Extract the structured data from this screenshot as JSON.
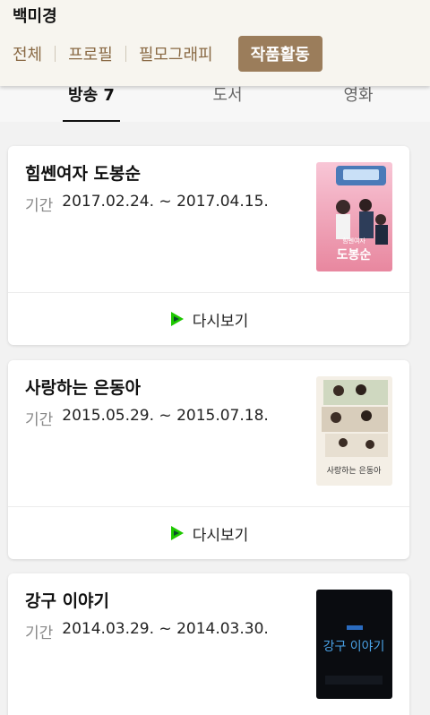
{
  "header": {
    "name": "백미경",
    "tabs": [
      {
        "label": "전체"
      },
      {
        "label": "프로필"
      },
      {
        "label": "필모그래피"
      },
      {
        "label": "작품활동"
      }
    ]
  },
  "subtabs": [
    {
      "label": "방송 7"
    },
    {
      "label": "도서"
    },
    {
      "label": "영화"
    }
  ],
  "works": [
    {
      "title": "힘쎈여자 도봉순",
      "period_label": "기간",
      "period": "2017.02.24. ~ 2017.04.15.",
      "poster_text": "힘쎈여자 도봉순",
      "replay_label": "다시보기"
    },
    {
      "title": "사랑하는 은동아",
      "period_label": "기간",
      "period": "2015.05.29. ~ 2015.07.18.",
      "poster_text": "사랑하는 은동아",
      "replay_label": "다시보기"
    },
    {
      "title": "강구 이야기",
      "period_label": "기간",
      "period": "2014.03.29. ~ 2014.03.30.",
      "poster_text": "강구 이야기"
    }
  ],
  "colors": {
    "accent": "#9b7d5b",
    "tab_text": "#8a6a45",
    "replay_icon": "#1ec800"
  }
}
